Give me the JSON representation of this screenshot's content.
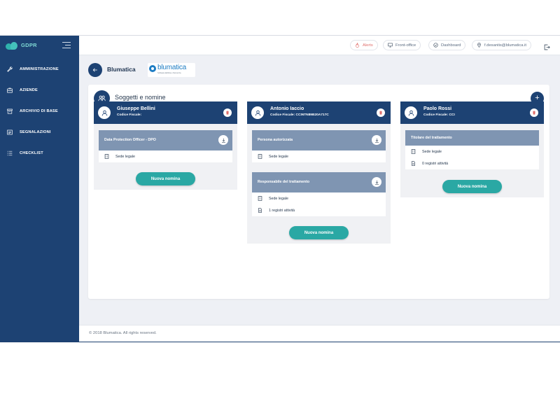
{
  "sidebar": {
    "brand": "GDPR",
    "brand_icon": "cloud-logo-icon",
    "items": [
      {
        "label": "AMMINISTRAZIONE",
        "icon": "wrench-icon"
      },
      {
        "label": "AZIENDE",
        "icon": "briefcase-icon"
      },
      {
        "label": "ARCHIVIO DI BASE",
        "icon": "archive-icon"
      },
      {
        "label": "SEGNALAZIONI",
        "icon": "report-icon"
      },
      {
        "label": "CHECKLIST",
        "icon": "checklist-icon"
      }
    ]
  },
  "topbar": {
    "alerts": "Alerts",
    "front_office": "Front-office",
    "dashboard": "Dashboard",
    "user": "f.desantis@blumatica.it"
  },
  "header": {
    "company": "Blumatica",
    "logo_text": "blumatica",
    "logo_sub": "Software Edilizia e Sicurezza"
  },
  "panel": {
    "title": "Soggetti e nomine"
  },
  "columns": [
    {
      "name": "Giuseppe Bellini",
      "cf": "Codice Fiscale:",
      "roles": [
        {
          "title": "Data Protection Officer - DPO",
          "rows": [
            {
              "label": "Sede legale",
              "icon": "building-icon"
            }
          ]
        }
      ],
      "button": "Nuova nomina"
    },
    {
      "name": "Antonio Iaccio",
      "cf": "Codice Fiscale: CCINTN89B20A717C",
      "roles": [
        {
          "title": "Persona autorizzata",
          "rows": [
            {
              "label": "Sede legale",
              "icon": "building-icon"
            }
          ]
        },
        {
          "title": "Responsabile del trattamento",
          "rows": [
            {
              "label": "Sede legale",
              "icon": "building-icon"
            },
            {
              "label": "1 registri attività",
              "icon": "document-icon"
            }
          ]
        }
      ],
      "button": "Nuova nomina"
    },
    {
      "name": "Paolo Rossi",
      "cf": "Codice Fiscale: CCI",
      "roles": [
        {
          "title": "Titolare del trattamento",
          "rows": [
            {
              "label": "Sede legale",
              "icon": "building-icon"
            },
            {
              "label": "0 registri attività",
              "icon": "document-icon"
            }
          ]
        }
      ],
      "button": "Nuova nomina"
    }
  ],
  "footer": "© 2018 Blumatica. All rights reserved.",
  "colors": {
    "primary": "#1d4273",
    "accent": "#2aa8a4",
    "role_header": "#7f95b2",
    "alert": "#e0706d"
  }
}
